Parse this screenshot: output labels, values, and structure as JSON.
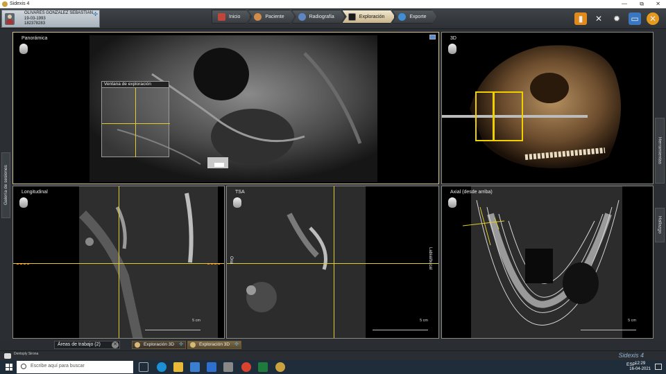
{
  "window": {
    "title": "Sidexis 4",
    "controls": [
      "—",
      "⧉",
      "✕"
    ]
  },
  "patient": {
    "name": "OLIVARES GONZALEZ SEBASTIAN",
    "dob": "19-03-1993",
    "id": "182378283"
  },
  "nav_tabs": [
    {
      "label": "Inicio",
      "icon": "home-icon",
      "color": "#c0463c"
    },
    {
      "label": "Paciente",
      "icon": "patient-icon",
      "color": "#cf8c4a"
    },
    {
      "label": "Radiografía",
      "icon": "xray-device-icon",
      "color": "#5e86c2"
    },
    {
      "label": "Exploración",
      "icon": "exploration-icon",
      "color": "#1a1a1a",
      "active": true
    },
    {
      "label": "Exporte",
      "icon": "export-icon",
      "color": "#3f8fd2"
    }
  ],
  "tools": [
    {
      "icon": "lock-icon",
      "color": "#e08a1e"
    },
    {
      "icon": "tools-icon",
      "color": "transparent"
    },
    {
      "icon": "gear-icon",
      "color": "transparent"
    },
    {
      "icon": "monitor-icon",
      "color": "#3b76c0"
    },
    {
      "icon": "close-circle-icon",
      "color": "#e39a1e"
    }
  ],
  "panels": {
    "panoramic": {
      "title": "Panorámica",
      "window_label": "Ventana de exploración"
    },
    "threed": {
      "title": "3D"
    },
    "longitudinal": {
      "title": "Longitudinal",
      "scale": "5 cm"
    },
    "tsa": {
      "title": "TSA",
      "scale": "5 cm",
      "left_label": "Oral",
      "right_label": "Labial/bucal"
    },
    "axial": {
      "title": "Axial (desde arriba)",
      "scale": "5 cm"
    }
  },
  "side_tabs": {
    "left": "Galería de sesiones",
    "right_top": "Herramientas",
    "right_bottom": "Hallazgo"
  },
  "bottom_bar": {
    "areas": "Áreas de trabajo (2)",
    "sessions": [
      {
        "label": "Exploración 3D",
        "active": false
      },
      {
        "label": "Exploración 3D",
        "active": true
      }
    ]
  },
  "footer": {
    "brand": "Dentsply Sirona",
    "product": "Sidexis 4"
  },
  "taskbar": {
    "search_placeholder": "Escribe aquí para buscar",
    "language": "ESP",
    "time": "12:29",
    "date": "16-04-2021"
  }
}
